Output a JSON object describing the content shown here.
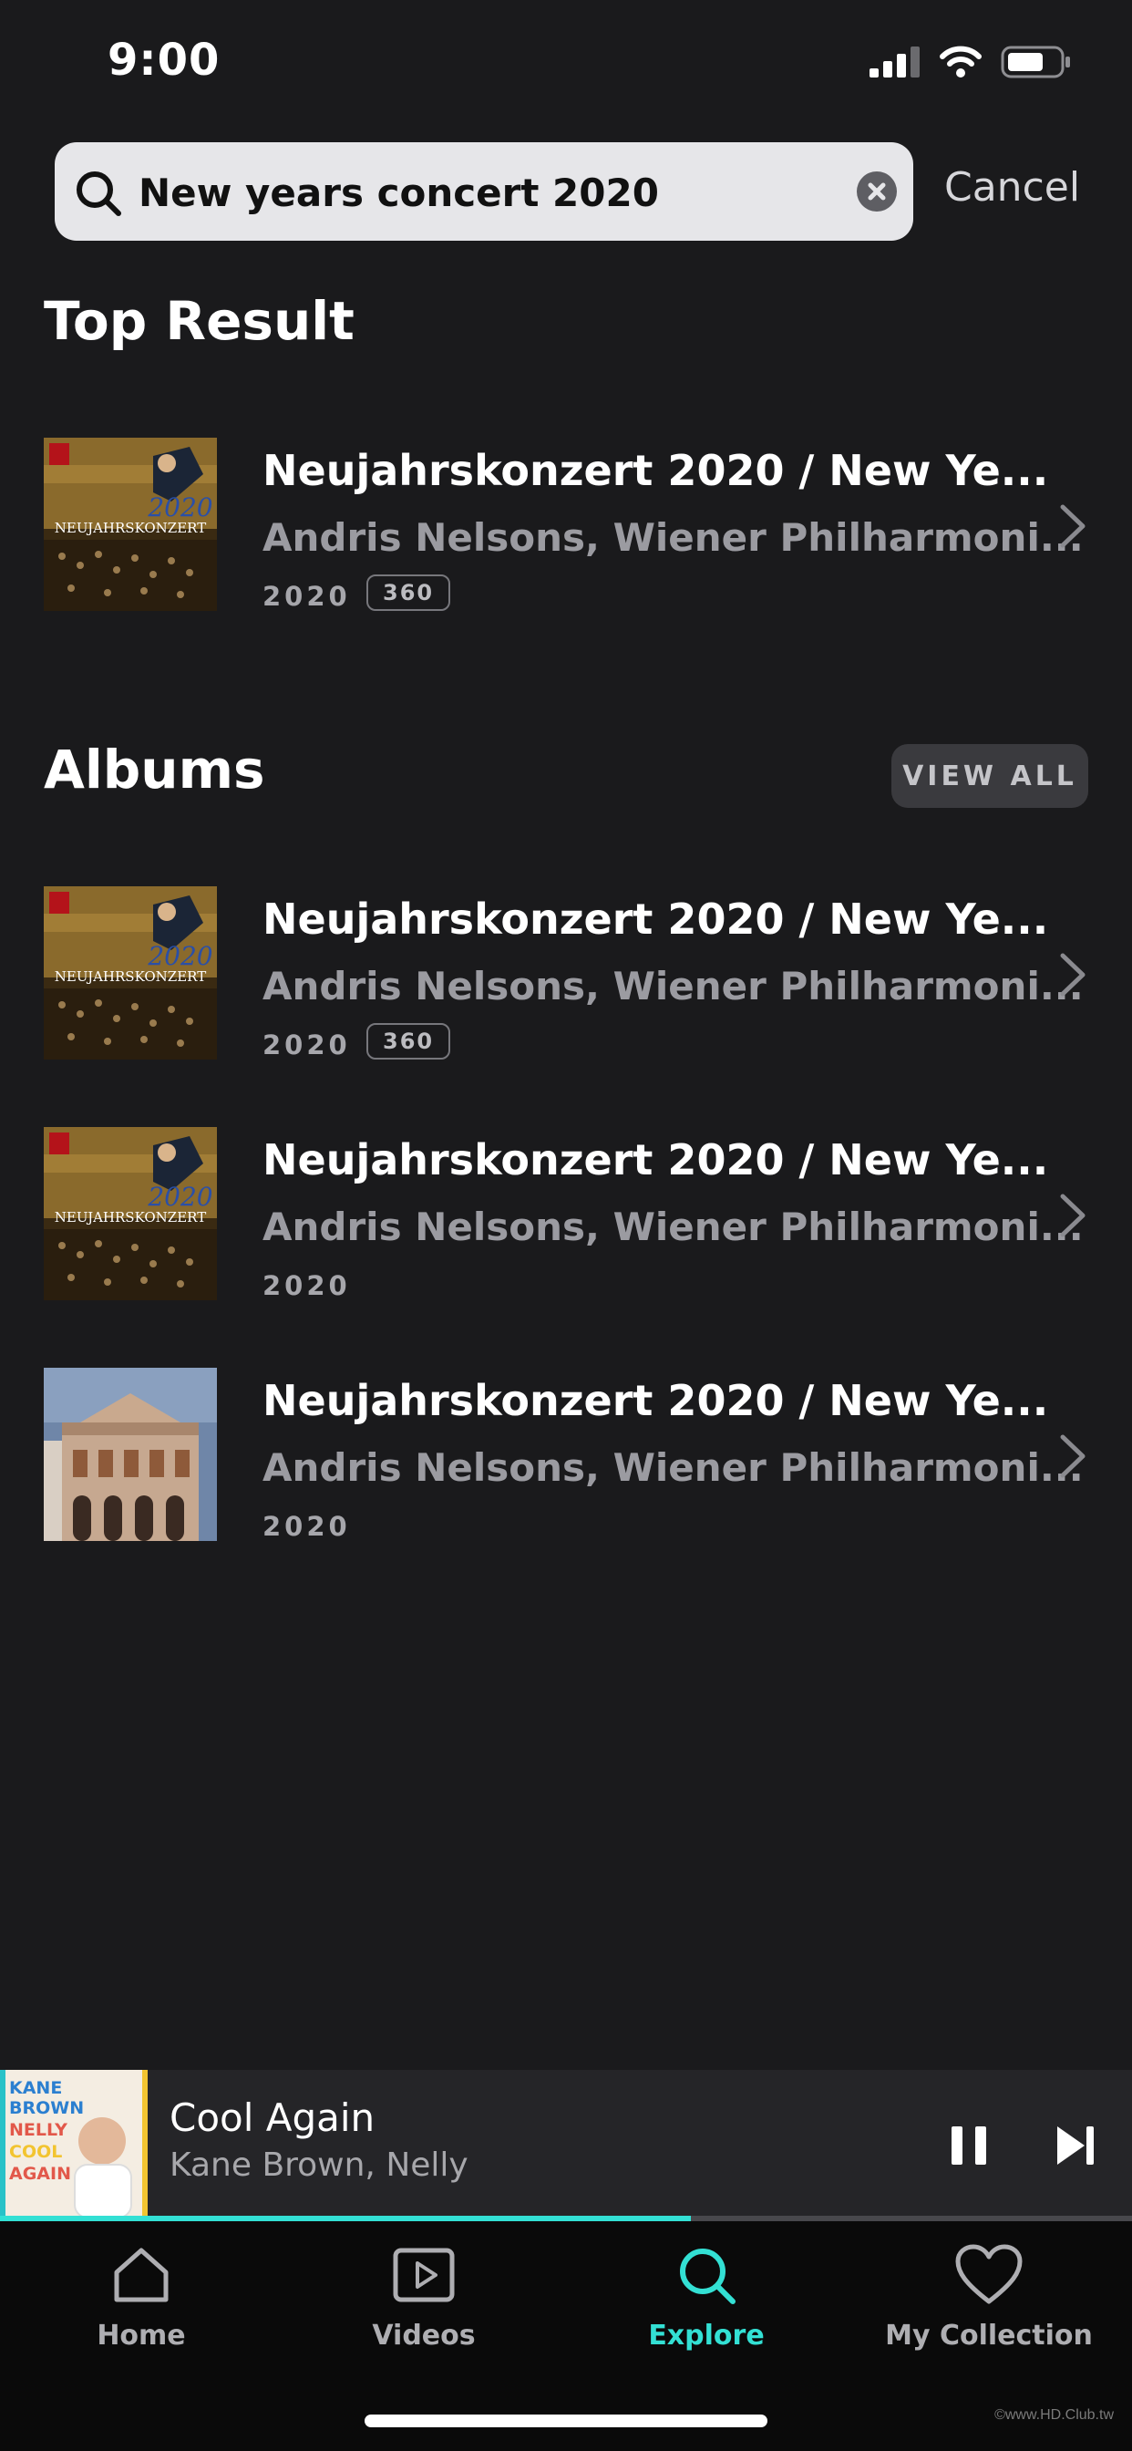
{
  "status_bar": {
    "time": "9:00"
  },
  "search": {
    "query": "New years concert 2020",
    "cancel_label": "Cancel"
  },
  "top_result": {
    "heading": "Top Result",
    "item": {
      "title": "Neujahrskonzert 2020 / New Ye...",
      "artist": "Andris Nelsons, Wiener Philharmoni...",
      "year": "2020",
      "badge": "360",
      "cover": "concert-cover"
    }
  },
  "albums": {
    "heading": "Albums",
    "view_all_label": "VIEW ALL",
    "items": [
      {
        "title": "Neujahrskonzert 2020 / New Ye...",
        "artist": "Andris Nelsons, Wiener Philharmoni...",
        "year": "2020",
        "badge": "360",
        "cover": "concert-cover"
      },
      {
        "title": "Neujahrskonzert 2020 / New Ye...",
        "artist": "Andris Nelsons, Wiener Philharmoni...",
        "year": "2020",
        "cover": "concert-cover"
      },
      {
        "title": "Neujahrskonzert 2020 / New Ye...",
        "artist": "Andris Nelsons, Wiener Philharmoni...",
        "year": "2020",
        "cover": "building-cover"
      }
    ]
  },
  "now_playing": {
    "title": "Cool Again",
    "artist": "Kane Brown, Nelly",
    "progress": 0.61,
    "cover_lines": [
      "KANE",
      "BROWN",
      "NELLY",
      "COOL",
      "AGAIN"
    ]
  },
  "tabs": [
    {
      "label": "Home",
      "icon": "home-icon",
      "active": false
    },
    {
      "label": "Videos",
      "icon": "video-icon",
      "active": false
    },
    {
      "label": "Explore",
      "icon": "search-icon",
      "active": true
    },
    {
      "label": "My Collection",
      "icon": "heart-icon",
      "active": false
    }
  ],
  "colors": {
    "accent": "#33e0d4",
    "background": "#1a1a1c"
  },
  "watermark": "©www.HD.Club.tw"
}
